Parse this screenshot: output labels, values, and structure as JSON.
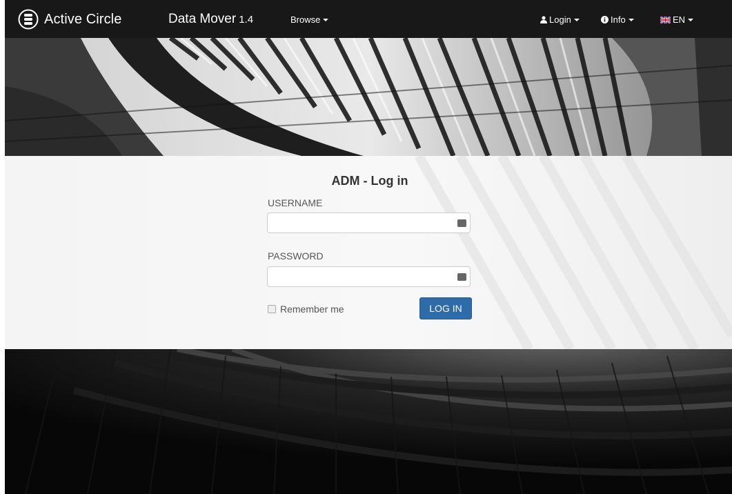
{
  "navbar": {
    "brand_name": "Active Circle",
    "product_name": "Data Mover",
    "product_version": "1.4",
    "browse_label": "Browse",
    "login_label": "Login",
    "info_label": "Info",
    "lang_label": "EN"
  },
  "login": {
    "title": "ADM - Log in",
    "username_label": "USERNAME",
    "username_value": "",
    "password_label": "PASSWORD",
    "password_value": "",
    "remember_label": "Remember me",
    "remember_checked": false,
    "submit_label": "LOG IN"
  },
  "colors": {
    "navbar_bg": "#181818",
    "button_primary": "#2d6ca8",
    "panel_bg": "#f5f5f5"
  },
  "icons": {
    "brand": "database-circle-icon",
    "user": "user-icon",
    "info": "info-circle-icon",
    "flag": "uk-flag-icon",
    "field_key": "key-icon"
  }
}
